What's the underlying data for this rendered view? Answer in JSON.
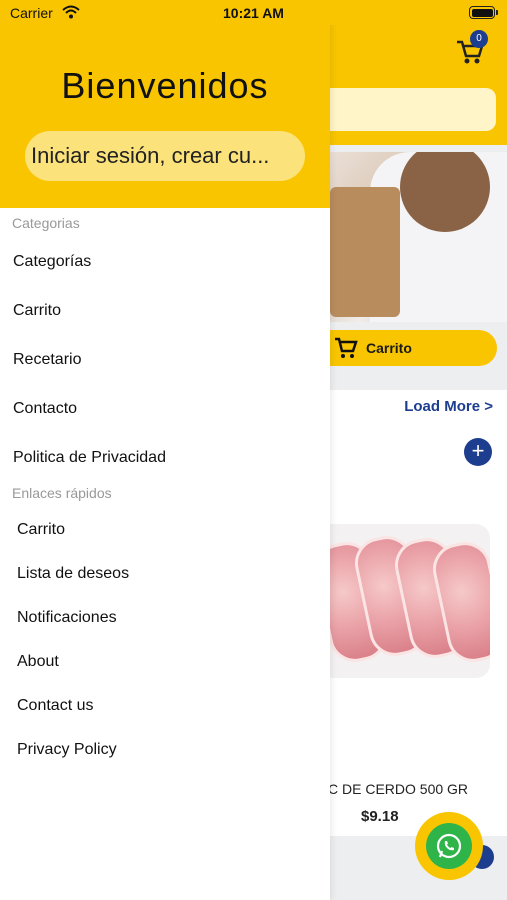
{
  "status_bar": {
    "carrier": "Carrier",
    "time": "10:21 AM"
  },
  "background": {
    "cart_count": "0",
    "cart_button_label": "Carrito",
    "load_more": "Load More >",
    "product_name": "C DE CERDO 500 GR",
    "product_price": "$9.18",
    "add_label": "+"
  },
  "drawer": {
    "title": "Bienvenidos",
    "login_label": "Iniciar sesión, crear cu...",
    "section_categories": "Categorias",
    "menu": [
      "Categorías",
      "Carrito",
      "Recetario",
      "Contacto",
      "Politica de Privacidad"
    ],
    "section_quick_links": "Enlaces rápidos",
    "quick_links": [
      "Carrito",
      "Lista de deseos",
      "Notificaciones",
      "About",
      "Contact us",
      "Privacy Policy"
    ]
  },
  "colors": {
    "brand_yellow": "#f9c500",
    "accent_blue": "#1d3d8f",
    "whatsapp_green": "#2fb44a"
  }
}
